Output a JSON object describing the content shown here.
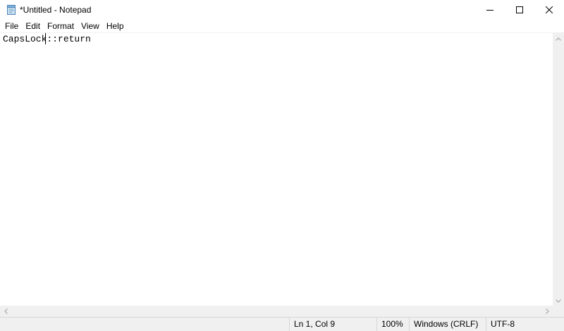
{
  "window": {
    "title": "*Untitled - Notepad",
    "app_icon": "notepad-icon",
    "controls": {
      "minimize_icon": "minimize-icon",
      "maximize_icon": "maximize-icon",
      "close_icon": "close-icon"
    }
  },
  "menubar": {
    "items": [
      {
        "label": "File"
      },
      {
        "label": "Edit"
      },
      {
        "label": "Format"
      },
      {
        "label": "View"
      },
      {
        "label": "Help"
      }
    ]
  },
  "editor": {
    "content": "CapsLock::return"
  },
  "statusbar": {
    "position": "Ln 1, Col 9",
    "zoom": "100%",
    "line_ending": "Windows (CRLF)",
    "encoding": "UTF-8"
  },
  "colors": {
    "background": "#ffffff",
    "chrome": "#f0f0f0",
    "border": "#d7d7d7"
  }
}
